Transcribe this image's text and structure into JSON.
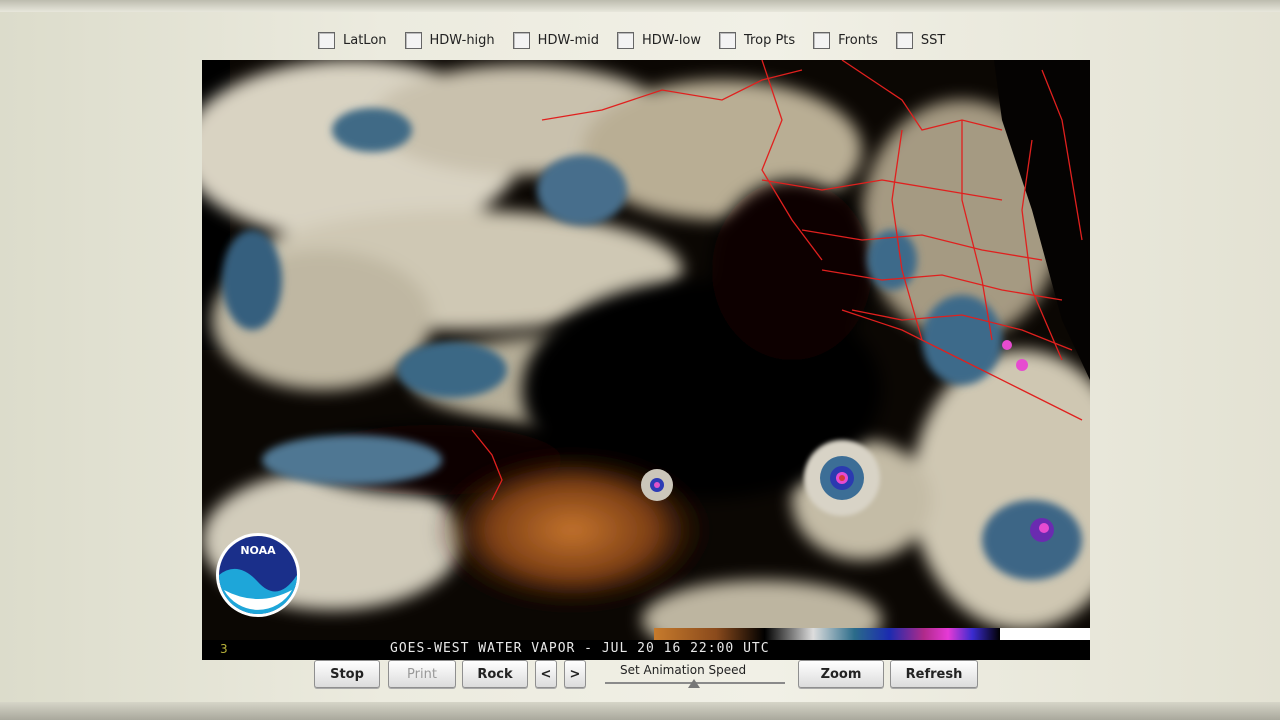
{
  "toolbar": {
    "options": [
      {
        "label": "LatLon"
      },
      {
        "label": "HDW-high"
      },
      {
        "label": "HDW-mid"
      },
      {
        "label": "HDW-low"
      },
      {
        "label": "Trop Pts"
      },
      {
        "label": "Fronts"
      },
      {
        "label": "SST"
      }
    ]
  },
  "viewer": {
    "frame_number": "3",
    "caption": "GOES-WEST WATER VAPOR  - JUL 20 16 22:00 UTC",
    "logo_text": "NOAA"
  },
  "controls": {
    "stop": "Stop",
    "print": "Print",
    "rock": "Rock",
    "prev": "<",
    "next": ">",
    "speed_label": "Set Animation Speed",
    "zoom": "Zoom",
    "refresh": "Refresh"
  },
  "colors": {
    "border_lines": "#e0201e",
    "colorbar_stops": [
      "#c77b2c",
      "#8a4a1c",
      "#000000",
      "#dddddd",
      "#2a6b8a",
      "#1b2bb0",
      "#b02a8a",
      "#e63ad6",
      "#3a2bd0"
    ]
  }
}
